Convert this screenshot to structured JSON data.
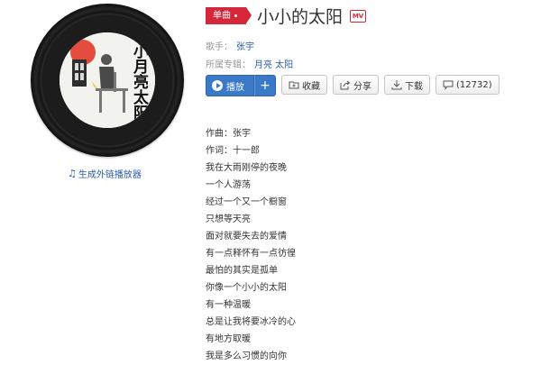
{
  "cover": {
    "text": "小月亮太阳",
    "sun_color": "#e23a2a",
    "disc_color": "#1c1c1c"
  },
  "sidebar": {
    "external_player_link": "生成外链播放器",
    "link_icon": "music-note-icon"
  },
  "song": {
    "type_badge": "单曲",
    "title": "小小的太阳",
    "mv_label": "MV",
    "singer_label": "歌手：",
    "singer": "张宇",
    "album_label": "所属专辑：",
    "album": "月亮 太阳"
  },
  "actions": {
    "play": "播放",
    "add": "+",
    "collect": "收藏",
    "share": "分享",
    "download": "下载",
    "comments": "(12732)"
  },
  "colors": {
    "accent": "#d6263a",
    "primary": "#3a79c7",
    "link": "#2a5caa"
  },
  "lyrics": [
    "作曲：张宇",
    "作词：十一郎",
    "我在大雨刚停的夜晚",
    "一个人游荡",
    "经过一个又一个橱窗",
    "只想等天亮",
    "面对就要失去的爱情",
    "有一点释怀有一点彷徨",
    "最怕的其实是孤单",
    "你像一个小小的太阳",
    "有一种温暖",
    "总是让我将要冰冷的心",
    "有地方取暖",
    "我是多么习惯的向你"
  ]
}
